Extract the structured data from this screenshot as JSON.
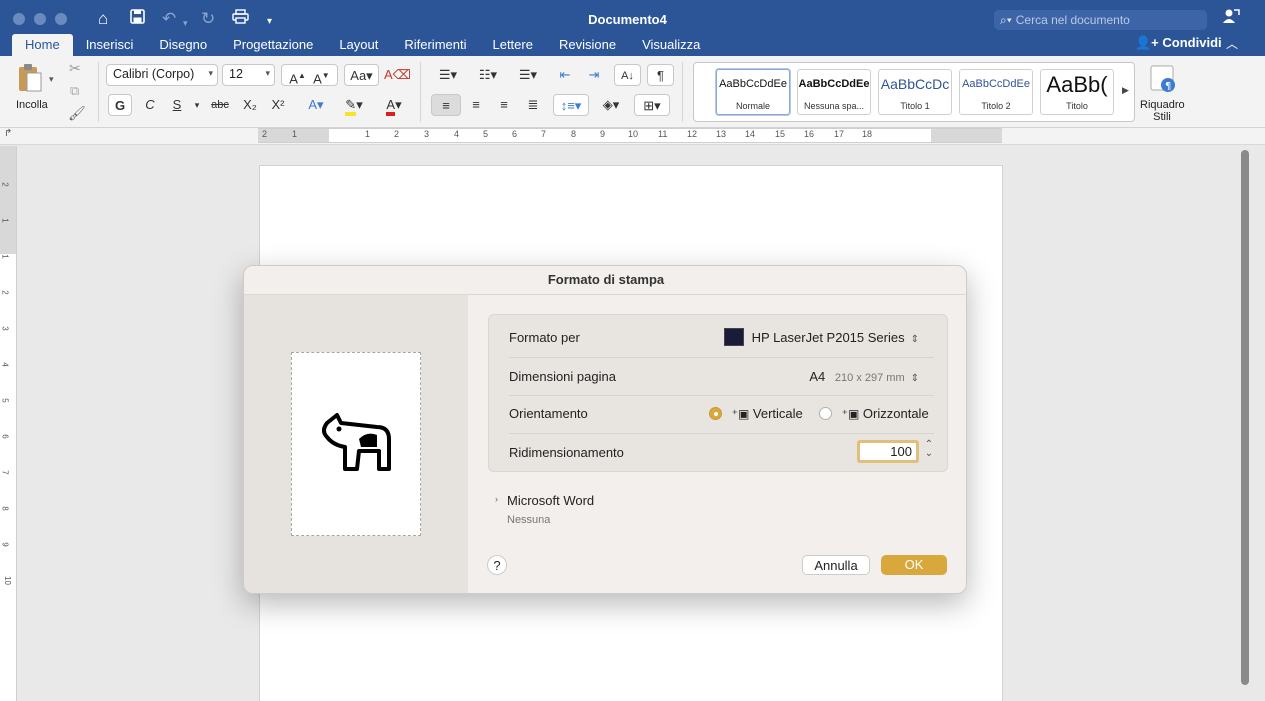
{
  "window": {
    "title": "Documento4",
    "search_placeholder": "Cerca nel documento",
    "share_label": "Condividi"
  },
  "tabs": [
    "Home",
    "Inserisci",
    "Disegno",
    "Progettazione",
    "Layout",
    "Riferimenti",
    "Lettere",
    "Revisione",
    "Visualizza"
  ],
  "ribbon": {
    "paste_label": "Incolla",
    "font_name": "Calibri (Corpo)",
    "font_size": "12",
    "bold": "G",
    "italic": "C",
    "underline": "S",
    "strikethrough": "abc",
    "subscript": "X₂",
    "superscript": "X²",
    "pilcrow": "¶",
    "styles": [
      {
        "sample": "AaBbCcDdEe",
        "name": "Normale"
      },
      {
        "sample": "AaBbCcDdEe",
        "name": "Nessuna spa..."
      },
      {
        "sample": "AaBbCcDc",
        "name": "Titolo 1"
      },
      {
        "sample": "AaBbCcDdEe",
        "name": "Titolo 2"
      },
      {
        "sample": "AaBb(",
        "name": "Titolo"
      }
    ],
    "styles_pane_label_1": "Riquadro",
    "styles_pane_label_2": "Stili"
  },
  "ruler": {
    "numbers": [
      "2",
      "1",
      "1",
      "2",
      "3",
      "4",
      "5",
      "6",
      "7",
      "8",
      "9",
      "10",
      "11",
      "12",
      "13",
      "14",
      "15",
      "16",
      "17",
      "18"
    ],
    "vnumbers": [
      "2",
      "1",
      "1",
      "2",
      "3",
      "4",
      "5",
      "6",
      "7",
      "8",
      "9",
      "10"
    ]
  },
  "dialog": {
    "title": "Formato di stampa",
    "format_for_label": "Formato per",
    "printer": "HP LaserJet P2015 Series",
    "page_size_label": "Dimensioni pagina",
    "page_size": "A4",
    "page_size_dims": "210 x 297 mm",
    "orientation_label": "Orientamento",
    "portrait_label": "Verticale",
    "landscape_label": "Orizzontale",
    "selected_orientation": "Verticale",
    "scale_label": "Ridimensionamento",
    "scale_value": "100",
    "app_section": "Microsoft Word",
    "app_section_value": "Nessuna",
    "help": "?",
    "cancel_label": "Annulla",
    "ok_label": "OK",
    "accent_color": "#d8a83d"
  }
}
